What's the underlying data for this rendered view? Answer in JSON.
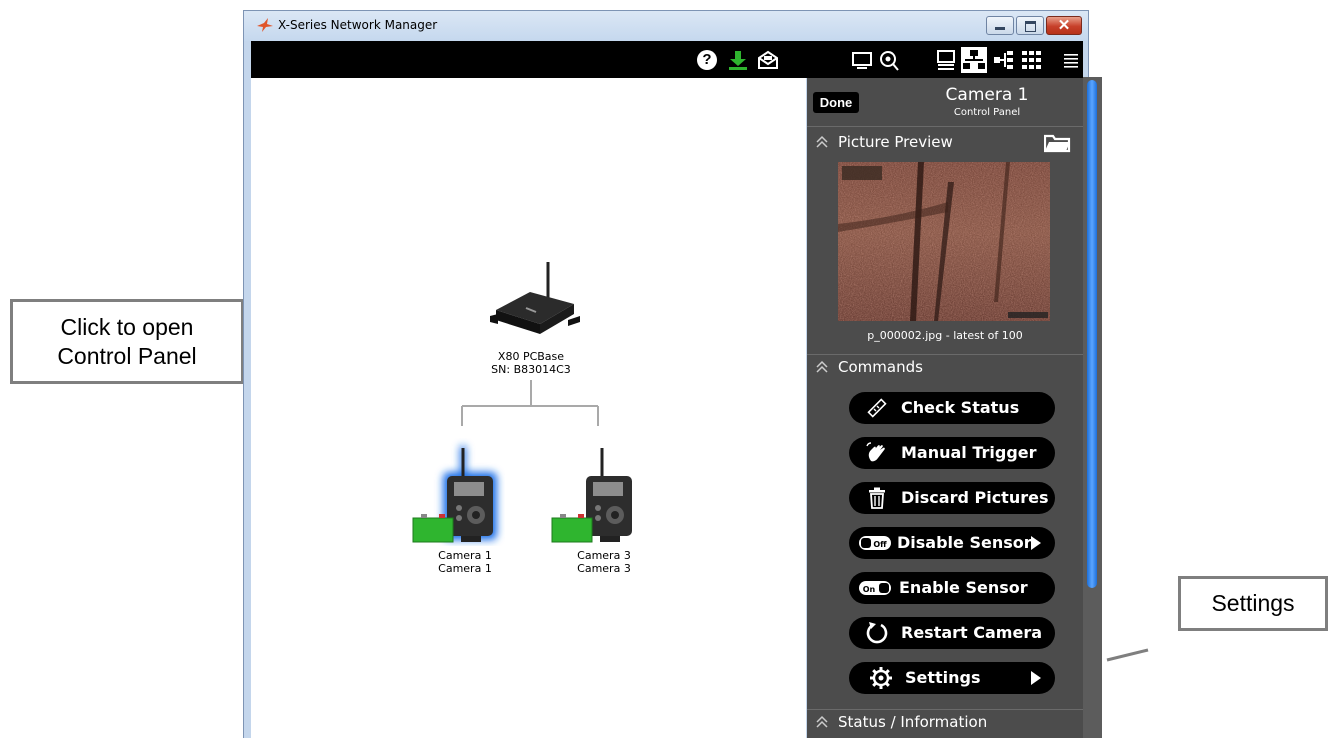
{
  "window": {
    "title": "X-Series Network Manager"
  },
  "toolbar": {
    "icons": [
      "help-icon",
      "download-icon",
      "mail-icon",
      "monitor-icon",
      "camera-search-icon",
      "image-list-icon",
      "network-tree-icon",
      "network-flow-icon",
      "grid-icon",
      "menu-icon"
    ],
    "help_label": "?"
  },
  "network": {
    "base": {
      "name": "X80 PCBase",
      "serial": "SN: B83014C3"
    },
    "cameras": [
      {
        "name": "Camera 1",
        "sublabel": "Camera 1",
        "selected": true
      },
      {
        "name": "Camera 3",
        "sublabel": "Camera 3",
        "selected": false
      }
    ]
  },
  "panel": {
    "done_label": "Done",
    "title": "Camera 1",
    "subtitle": "Control Panel",
    "preview": {
      "heading": "Picture Preview",
      "caption": "p_000002.jpg - latest of 100"
    },
    "commands": {
      "heading": "Commands",
      "items": [
        {
          "label": "Check Status",
          "icon": "ruler-icon",
          "has_arrow": false
        },
        {
          "label": "Manual Trigger",
          "icon": "hand-wave-icon",
          "has_arrow": false
        },
        {
          "label": "Discard Pictures",
          "icon": "trash-icon",
          "has_arrow": false
        },
        {
          "label": "Disable Sensor",
          "icon": "switch-off-icon",
          "has_arrow": true
        },
        {
          "label": "Enable Sensor",
          "icon": "switch-on-icon",
          "has_arrow": false
        },
        {
          "label": "Restart Camera",
          "icon": "restart-icon",
          "has_arrow": false
        },
        {
          "label": "Settings",
          "icon": "gear-icon",
          "has_arrow": true
        }
      ]
    },
    "status": {
      "heading": "Status / Information"
    }
  },
  "callouts": {
    "left": {
      "line1": "Click to open",
      "line2": "Control Panel"
    },
    "right": "Settings"
  },
  "colors": {
    "panel_bg": "#4c4c4c",
    "toolbar_bg": "#000000",
    "selection_glow": "#1e6fe8",
    "scroll_thumb": "#2a7fe6",
    "battery_green": "#2fb52f"
  }
}
